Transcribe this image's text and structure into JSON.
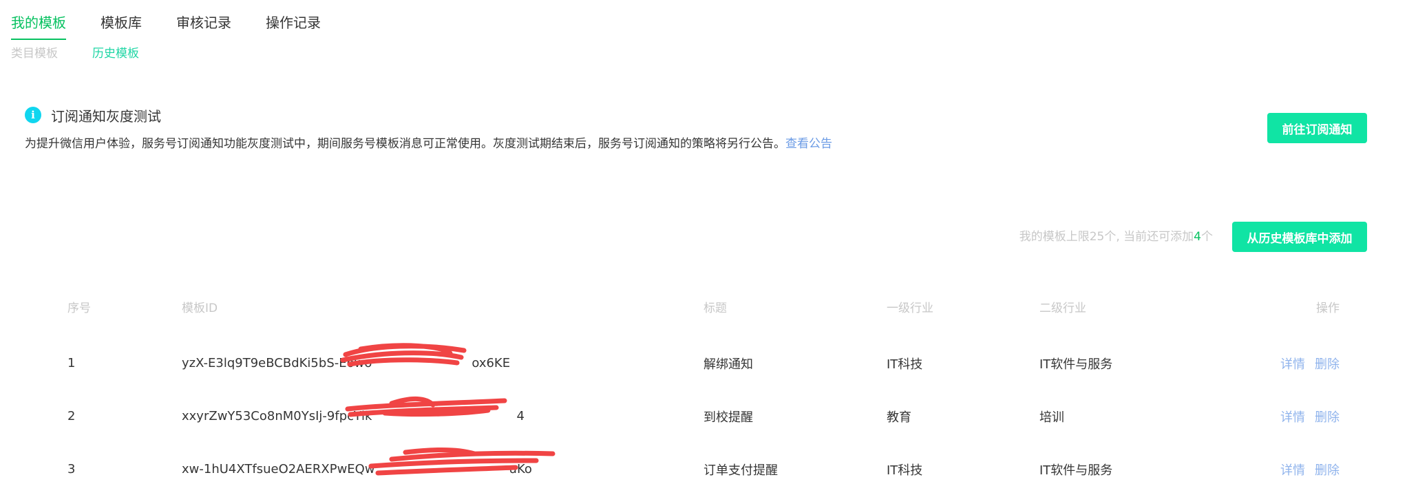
{
  "tabs": [
    {
      "label": "我的模板",
      "active": true
    },
    {
      "label": "模板库",
      "active": false
    },
    {
      "label": "审核记录",
      "active": false
    },
    {
      "label": "操作记录",
      "active": false
    }
  ],
  "sub_tabs": [
    {
      "label": "类目模板",
      "active": false
    },
    {
      "label": "历史模板",
      "active": true
    }
  ],
  "notice": {
    "icon": "info-icon",
    "icon_glyph": "i",
    "title": "订阅通知灰度测试",
    "description": "为提升微信用户体验，服务号订阅通知功能灰度测试中，期间服务号模板消息可正常使用。灰度测试期结束后，服务号订阅通知的策略将另行公告。",
    "link": "查看公告",
    "button": "前往订阅通知"
  },
  "limit": {
    "prefix": "我的模板上限25个, 当前还可添加",
    "count": "4",
    "suffix": "个"
  },
  "add_button": "从历史模板库中添加",
  "table": {
    "headers": {
      "index": "序号",
      "template_id": "模板ID",
      "title": "标题",
      "industry1": "一级行业",
      "industry2": "二级行业",
      "actions": "操作"
    },
    "rows": [
      {
        "index": "1",
        "template_id": "yzX-E3lq9T9eBCBdKi5bS-Eowo",
        "template_id_tail": "ox6KE",
        "title": "解绑通知",
        "industry1": "IT科技",
        "industry2": "IT软件与服务",
        "detail": "详情",
        "delete": "删除"
      },
      {
        "index": "2",
        "template_id": "xxyrZwY53Co8nM0YsIj-9fpcYlk",
        "template_id_tail": "4",
        "title": "到校提醒",
        "industry1": "教育",
        "industry2": "培训",
        "detail": "详情",
        "delete": "删除"
      },
      {
        "index": "3",
        "template_id": "xw-1hU4XTfsueO2AERXPwEQw",
        "template_id_tail": "uKo",
        "title": "订单支付提醒",
        "industry1": "IT科技",
        "industry2": "IT软件与服务",
        "detail": "详情",
        "delete": "删除"
      }
    ]
  },
  "colors": {
    "accent": "#07c160",
    "button": "#10e4a4",
    "link": "#6b9be5",
    "redaction": "#f04444"
  }
}
